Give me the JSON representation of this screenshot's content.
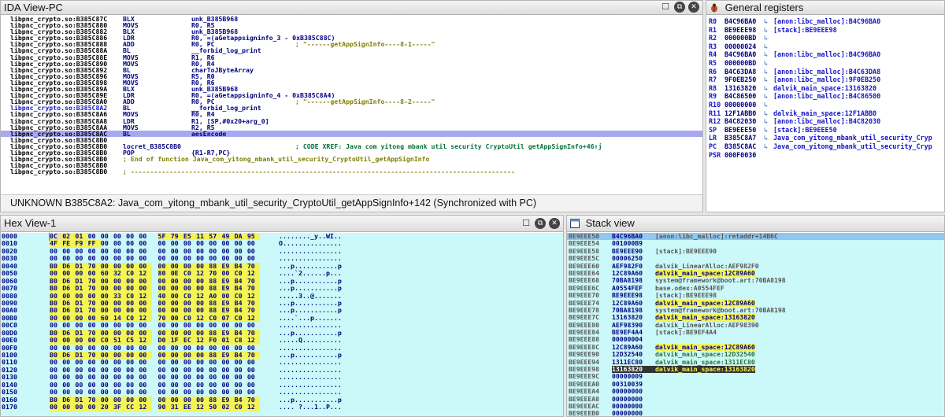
{
  "ida": {
    "title": "IDA View-PC",
    "status": "UNKNOWN  B385C8A2: Java_com_yitong_mbank_util_security_CryptoUtil_getAppSignInfo+142  (Synchronized with PC)",
    "lines": [
      {
        "addr": "libpnc_crypto.so:B385C87C",
        "mn": "BLX",
        "op": "unk_B385B968",
        "cm": ""
      },
      {
        "addr": "libpnc_crypto.so:B385C880",
        "mn": "MOVS",
        "op": "R0, R5",
        "cm": ""
      },
      {
        "addr": "libpnc_crypto.so:B385C882",
        "mn": "BLX",
        "op": "unk_B385B968",
        "cm": ""
      },
      {
        "addr": "libpnc_crypto.so:B385C886",
        "mn": "LDR",
        "op": "R0, =(aGetappsigninfo_3 - 0xB385C88C)",
        "cm": ""
      },
      {
        "addr": "libpnc_crypto.so:B385C888",
        "mn": "ADD",
        "op": "R0, PC",
        "cm": "; \"------getAppSignInfo----8-1-----\""
      },
      {
        "addr": "libpnc_crypto.so:B385C88A",
        "mn": "BL",
        "op": "__forbid_log_print",
        "cm": ""
      },
      {
        "addr": "libpnc_crypto.so:B385C88E",
        "mn": "MOVS",
        "op": "R1, R6",
        "cm": ""
      },
      {
        "addr": "libpnc_crypto.so:B385C890",
        "mn": "MOVS",
        "op": "R0, R4",
        "cm": ""
      },
      {
        "addr": "libpnc_crypto.so:B385C892",
        "mn": "BL",
        "op": "charToJByteArray",
        "cm": ""
      },
      {
        "addr": "libpnc_crypto.so:B385C896",
        "mn": "MOVS",
        "op": "R5, R0",
        "cm": ""
      },
      {
        "addr": "libpnc_crypto.so:B385C898",
        "mn": "MOVS",
        "op": "R0, R6",
        "cm": ""
      },
      {
        "addr": "libpnc_crypto.so:B385C89A",
        "mn": "BLX",
        "op": "unk_B385B968",
        "cm": ""
      },
      {
        "addr": "libpnc_crypto.so:B385C89E",
        "mn": "LDR",
        "op": "R0, =(aGetappsigninfo_4 - 0xB385C8A4)",
        "cm": ""
      },
      {
        "addr": "libpnc_crypto.so:B385C8A0",
        "mn": "ADD",
        "op": "R0, PC",
        "cm": "; \"------getAppSignInfo----8-2-----\""
      },
      {
        "addr": "libpnc_crypto.so:B385C8A2",
        "mn": "BL",
        "op": "__forbid_log_print",
        "cm": "",
        "blue": true
      },
      {
        "addr": "libpnc_crypto.so:B385C8A6",
        "mn": "MOVS",
        "op": "R0, R4",
        "cm": ""
      },
      {
        "addr": "libpnc_crypto.so:B385C8A8",
        "mn": "LDR",
        "op": "R1, [SP,#0x20+arg_0]",
        "cm": ""
      },
      {
        "addr": "libpnc_crypto.so:B385C8AA",
        "mn": "MOVS",
        "op": "R2, R5",
        "cm": ""
      },
      {
        "addr": "libpnc_crypto.so:B385C8AC",
        "mn": "BL",
        "op": "aesEncode",
        "cm": "",
        "hl": true
      },
      {
        "addr": "libpnc_crypto.so:B385C8B0",
        "mn": "",
        "op": "",
        "cm": ""
      },
      {
        "addr": "libpnc_crypto.so:B385C8B0",
        "mn": "locret_B385C8B0",
        "op": "",
        "cm": "; CODE XREF: Java com yitong mbank util security CryptoUtil getAppSignInfo+46↑j",
        "xref": true
      },
      {
        "addr": "libpnc_crypto.so:B385C8B0",
        "mn": "POP",
        "op": "{R1-R7,PC}",
        "cm": ""
      },
      {
        "addr": "libpnc_crypto.so:B385C8B0",
        "mn": "; End of function Java_com_yitong_mbank_util_security_CryptoUtil_getAppSignInfo",
        "op": "",
        "cm": "",
        "plain": true
      },
      {
        "addr": "libpnc_crypto.so:B385C8B0",
        "mn": "",
        "op": "",
        "cm": ""
      },
      {
        "addr": "libpnc_crypto.so:B385C8B0",
        "mn": "; ---------------------------------------------------------------------------------------------------",
        "op": "",
        "cm": "",
        "plain": true
      }
    ]
  },
  "regs": {
    "title": "General registers",
    "rows": [
      {
        "n": "R0",
        "v": "B4C96BA0",
        "a": "↳",
        "d": "[anon:libc_malloc]:B4C96BA0"
      },
      {
        "n": "R1",
        "v": "BE9EEE98",
        "a": "↳",
        "d": "[stack]:BE9EEE98"
      },
      {
        "n": "R2",
        "v": "000000BD",
        "a": "↳",
        "d": ""
      },
      {
        "n": "R3",
        "v": "00000024",
        "a": "↳",
        "d": ""
      },
      {
        "n": "R4",
        "v": "B4C96BA0",
        "a": "↳",
        "d": "[anon:libc_malloc]:B4C96BA0"
      },
      {
        "n": "R5",
        "v": "000000BD",
        "a": "↳",
        "d": ""
      },
      {
        "n": "R6",
        "v": "B4C63DA8",
        "a": "↳",
        "d": "[anon:libc_malloc]:B4C63DA8"
      },
      {
        "n": "R7",
        "v": "9F0EB250",
        "a": "↳",
        "d": "[anon:libc_malloc]:9F0EB250"
      },
      {
        "n": "R8",
        "v": "13163820",
        "a": "↳",
        "d": "dalvik_main_space:13163820"
      },
      {
        "n": "R9",
        "v": "B4C86500",
        "a": "↳",
        "d": "[anon:libc_malloc]:B4C86500"
      },
      {
        "n": "R10",
        "v": "00000000",
        "a": "↳",
        "d": ""
      },
      {
        "n": "R11",
        "v": "12F1ABB0",
        "a": "↳",
        "d": "dalvik_main_space:12F1ABB0"
      },
      {
        "n": "R12",
        "v": "B4C82030",
        "a": "↳",
        "d": "[anon:libc_malloc]:B4C82030"
      },
      {
        "n": "SP",
        "v": "BE9EEE50",
        "a": "↳",
        "d": "[stack]:BE9EEE50"
      },
      {
        "n": "LR",
        "v": "B385C8A7",
        "a": "↳",
        "d": "Java_com_yitong_mbank_util_security_Cryp"
      },
      {
        "n": "PC",
        "v": "B385C8AC",
        "a": "↳",
        "d": "Java_com_yitong_mbank_util_security_Cryp"
      },
      {
        "n": "PSR",
        "v": "000F0030",
        "a": "",
        "d": ""
      }
    ]
  },
  "hex": {
    "title": "Hex View-1",
    "rows": [
      {
        "o": "0000",
        "b": [
          "0C",
          "02",
          "01",
          "00",
          "00",
          "00",
          "00",
          "00",
          "5F",
          "79",
          "E5",
          "11",
          "57",
          "49",
          "DA",
          "95"
        ],
        "a": "........_y..WI.."
      },
      {
        "o": "0010",
        "b": [
          "4F",
          "FE",
          "F9",
          "FF",
          "00",
          "00",
          "00",
          "00",
          "00",
          "00",
          "00",
          "00",
          "00",
          "00",
          "00",
          "00"
        ],
        "a": "O..............."
      },
      {
        "o": "0020",
        "b": [
          "00",
          "00",
          "00",
          "00",
          "00",
          "00",
          "00",
          "00",
          "00",
          "00",
          "00",
          "00",
          "00",
          "00",
          "00",
          "00"
        ],
        "a": "................"
      },
      {
        "o": "0030",
        "b": [
          "00",
          "00",
          "00",
          "00",
          "00",
          "00",
          "00",
          "00",
          "00",
          "00",
          "00",
          "00",
          "00",
          "00",
          "00",
          "00"
        ],
        "a": "................"
      },
      {
        "o": "0040",
        "b": [
          "B0",
          "D6",
          "D1",
          "70",
          "00",
          "00",
          "00",
          "00",
          "00",
          "00",
          "00",
          "00",
          "88",
          "E9",
          "B4",
          "70"
        ],
        "a": "...p...........p"
      },
      {
        "o": "0050",
        "b": [
          "00",
          "00",
          "00",
          "00",
          "60",
          "32",
          "C0",
          "12",
          "80",
          "0E",
          "C0",
          "12",
          "70",
          "00",
          "C0",
          "12"
        ],
        "a": "....`2......p..."
      },
      {
        "o": "0060",
        "b": [
          "B0",
          "D6",
          "D1",
          "70",
          "00",
          "00",
          "00",
          "00",
          "00",
          "00",
          "00",
          "00",
          "88",
          "E9",
          "B4",
          "70"
        ],
        "a": "...p...........p"
      },
      {
        "o": "0070",
        "b": [
          "B0",
          "D6",
          "D1",
          "70",
          "00",
          "00",
          "00",
          "00",
          "00",
          "00",
          "00",
          "00",
          "88",
          "E9",
          "B4",
          "70"
        ],
        "a": "...p...........p"
      },
      {
        "o": "0080",
        "b": [
          "00",
          "00",
          "00",
          "00",
          "00",
          "33",
          "C0",
          "12",
          "40",
          "00",
          "C0",
          "12",
          "A0",
          "00",
          "C0",
          "12"
        ],
        "a": ".....3..@......."
      },
      {
        "o": "0090",
        "b": [
          "B0",
          "D6",
          "D1",
          "70",
          "00",
          "00",
          "00",
          "00",
          "00",
          "00",
          "00",
          "00",
          "88",
          "E9",
          "B4",
          "70"
        ],
        "a": "...p...........p"
      },
      {
        "o": "00A0",
        "b": [
          "B0",
          "D6",
          "D1",
          "70",
          "00",
          "00",
          "00",
          "00",
          "00",
          "00",
          "00",
          "00",
          "88",
          "E9",
          "B4",
          "70"
        ],
        "a": "...p...........p"
      },
      {
        "o": "00B0",
        "b": [
          "00",
          "00",
          "00",
          "00",
          "60",
          "14",
          "C0",
          "12",
          "70",
          "00",
          "C0",
          "12",
          "C0",
          "07",
          "C0",
          "12"
        ],
        "a": "....`...p......."
      },
      {
        "o": "00C0",
        "b": [
          "00",
          "00",
          "00",
          "00",
          "00",
          "00",
          "00",
          "00",
          "00",
          "00",
          "00",
          "00",
          "00",
          "00",
          "00",
          "00"
        ],
        "a": "................"
      },
      {
        "o": "00D0",
        "b": [
          "B0",
          "D6",
          "D1",
          "70",
          "00",
          "00",
          "00",
          "00",
          "00",
          "00",
          "00",
          "00",
          "88",
          "E9",
          "B4",
          "70"
        ],
        "a": "...p...........p"
      },
      {
        "o": "00E0",
        "b": [
          "00",
          "00",
          "00",
          "00",
          "C0",
          "51",
          "C5",
          "12",
          "D0",
          "1F",
          "EC",
          "12",
          "F0",
          "01",
          "C8",
          "12"
        ],
        "a": ".....Q.........."
      },
      {
        "o": "00F0",
        "b": [
          "00",
          "00",
          "00",
          "00",
          "00",
          "00",
          "00",
          "00",
          "00",
          "00",
          "00",
          "00",
          "00",
          "00",
          "00",
          "00"
        ],
        "a": "................"
      },
      {
        "o": "0100",
        "b": [
          "B0",
          "D6",
          "D1",
          "70",
          "00",
          "00",
          "00",
          "00",
          "00",
          "00",
          "00",
          "00",
          "88",
          "E9",
          "B4",
          "70"
        ],
        "a": "...p...........p"
      },
      {
        "o": "0110",
        "b": [
          "00",
          "00",
          "00",
          "00",
          "00",
          "00",
          "00",
          "00",
          "00",
          "00",
          "00",
          "00",
          "00",
          "00",
          "00",
          "00"
        ],
        "a": "................"
      },
      {
        "o": "0120",
        "b": [
          "00",
          "00",
          "00",
          "00",
          "00",
          "00",
          "00",
          "00",
          "00",
          "00",
          "00",
          "00",
          "00",
          "00",
          "00",
          "00"
        ],
        "a": "................"
      },
      {
        "o": "0130",
        "b": [
          "00",
          "00",
          "00",
          "00",
          "00",
          "00",
          "00",
          "00",
          "00",
          "00",
          "00",
          "00",
          "00",
          "00",
          "00",
          "00"
        ],
        "a": "................"
      },
      {
        "o": "0140",
        "b": [
          "00",
          "00",
          "00",
          "00",
          "00",
          "00",
          "00",
          "00",
          "00",
          "00",
          "00",
          "00",
          "00",
          "00",
          "00",
          "00"
        ],
        "a": "................"
      },
      {
        "o": "0150",
        "b": [
          "00",
          "00",
          "00",
          "00",
          "00",
          "00",
          "00",
          "00",
          "00",
          "00",
          "00",
          "00",
          "00",
          "00",
          "00",
          "00"
        ],
        "a": "................"
      },
      {
        "o": "0160",
        "b": [
          "B0",
          "D6",
          "D1",
          "70",
          "00",
          "00",
          "00",
          "00",
          "00",
          "00",
          "00",
          "00",
          "88",
          "E9",
          "B4",
          "70"
        ],
        "a": "...p...........p"
      },
      {
        "o": "0170",
        "b": [
          "00",
          "00",
          "00",
          "00",
          "20",
          "3F",
          "CC",
          "12",
          "90",
          "31",
          "EE",
          "12",
          "50",
          "02",
          "C0",
          "12"
        ],
        "a": ".... ?...1..P..."
      }
    ]
  },
  "stack": {
    "title": "Stack view",
    "rows": [
      {
        "a": "BE9EEE50",
        "v": "B4C96BA0",
        "d": "[anon:libc_malloc]:retaddr+14B6C",
        "t": "top"
      },
      {
        "a": "BE9EEE54",
        "v": "001000B9",
        "d": ""
      },
      {
        "a": "BE9EEE58",
        "v": "BE9EEE90",
        "d": "[stack]:BE9EEE90"
      },
      {
        "a": "BE9EEE5C",
        "v": "00006250",
        "d": ""
      },
      {
        "a": "BE9EEE60",
        "v": "AEF982F0",
        "d": "dalvik_LinearAlloc:AEF982F0"
      },
      {
        "a": "BE9EEE64",
        "v": "12C89A60",
        "d": "dalvik_main_space:12C89A60",
        "t": "y"
      },
      {
        "a": "BE9EEE68",
        "v": "70BA8198",
        "d": "system@framework@boot.art:70BA8198"
      },
      {
        "a": "BE9EEE6C",
        "v": "A0554FEF",
        "d": "base.odex:A0554FEF"
      },
      {
        "a": "BE9EEE70",
        "v": "BE9EEE98",
        "d": "[stack]:BE9EEE98"
      },
      {
        "a": "BE9EEE74",
        "v": "12C89A60",
        "d": "dalvik_main_space:12C89A60",
        "t": "y"
      },
      {
        "a": "BE9EEE78",
        "v": "70BA8198",
        "d": "system@framework@boot.art:70BA8198"
      },
      {
        "a": "BE9EEE7C",
        "v": "13163820",
        "d": "dalvik_main_space:13163820",
        "t": "y"
      },
      {
        "a": "BE9EEE80",
        "v": "AEF98390",
        "d": "dalvik_LinearAlloc:AEF98390"
      },
      {
        "a": "BE9EEE84",
        "v": "BE9EF4A4",
        "d": "[stack]:BE9EF4A4"
      },
      {
        "a": "BE9EEE88",
        "v": "00000004",
        "d": ""
      },
      {
        "a": "BE9EEE8C",
        "v": "12C89A60",
        "d": "dalvik_main_space:12C89A60",
        "t": "y"
      },
      {
        "a": "BE9EEE90",
        "v": "12D32540",
        "d": "dalvik_main_space:12D32540",
        "t": "dal"
      },
      {
        "a": "BE9EEE94",
        "v": "1311EC80",
        "d": "dalvik_main_space:1311EC80",
        "t": "dal"
      },
      {
        "a": "BE9EEE98",
        "v": "13163820",
        "d": "dalvik_main_space:13163820",
        "t": "cur"
      },
      {
        "a": "BE9EEE9C",
        "v": "00000009",
        "d": ""
      },
      {
        "a": "BE9EEEA0",
        "v": "00310039",
        "d": ""
      },
      {
        "a": "BE9EEEA4",
        "v": "00000000",
        "d": ""
      },
      {
        "a": "BE9EEEA8",
        "v": "00000000",
        "d": ""
      },
      {
        "a": "BE9EEEAC",
        "v": "00000000",
        "d": ""
      },
      {
        "a": "BE9EEEB0",
        "v": "00000000",
        "d": ""
      }
    ]
  }
}
